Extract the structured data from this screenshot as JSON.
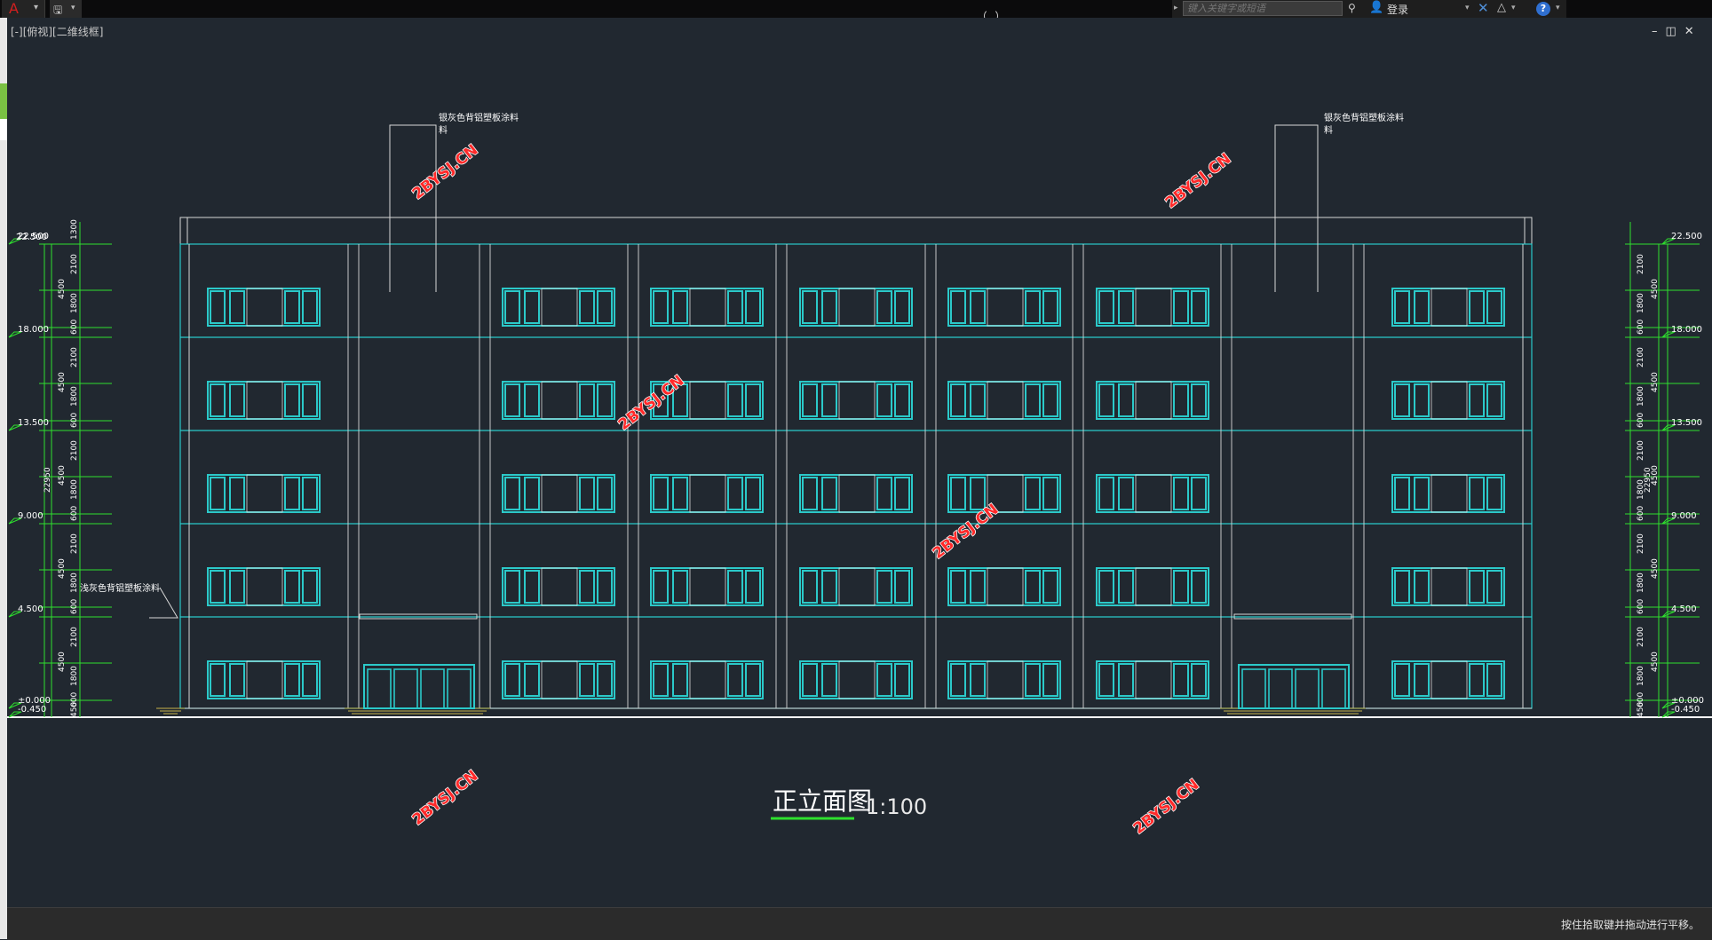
{
  "toolbar": {
    "app_logo": "A",
    "dropdown": "▾",
    "save_icon": "🖫",
    "search_placeholder": "键入关键字或短语",
    "login_label": "登录",
    "help_icon": "?"
  },
  "viewport": {
    "label": "[-][俯视][二维线框]",
    "controls": "–◫✕"
  },
  "drawing": {
    "title": "正立面图",
    "scale": "1:100",
    "watermark": "2BYSJ.CN",
    "note_roof": "银灰色背铝塑板涂料",
    "note_roof_2": "料",
    "note_wall": "浅灰色背铝塑板涂料",
    "elevations": [
      "22.500",
      "18.000",
      "13.500",
      "9.000",
      "4.500",
      "±0.000",
      "-0.450"
    ],
    "dims_floor": [
      "2100",
      "1800",
      "600"
    ],
    "dim_storey": "4500",
    "dim_top": "1300",
    "dim_ground": "450",
    "dim_total": "22950"
  },
  "status": {
    "message": "按住拾取键并拖动进行平移。"
  }
}
